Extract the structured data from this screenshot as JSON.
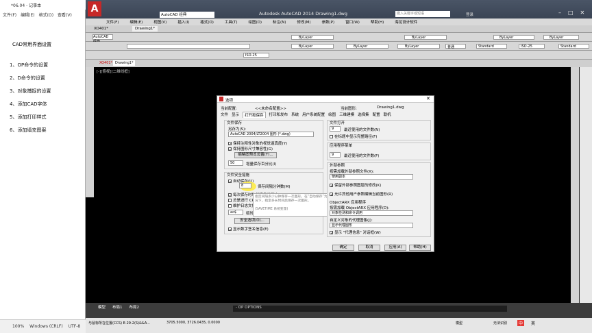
{
  "notepad": {
    "title": "*06.04 - 记事本",
    "menu": [
      "文件(F)",
      "编辑(E)",
      "格式(O)",
      "查看(V)",
      "帮助(H)"
    ],
    "heading": "CAD常用界面设置",
    "items": [
      "1、OP命令的设置",
      "2、D命令的设置",
      "3、对象捕捉的设置",
      "4、添加CAD字体",
      "5、添加打印样式",
      "6、添加填充图案"
    ],
    "status": [
      "100%",
      "Windows (CRLF)",
      "UTF-8"
    ]
  },
  "acad": {
    "workspace": "AutoCAD 经典",
    "title": "Autodesk AutoCAD 2014    Drawing1.dwg",
    "search_placeholder": "键入关键字或短语",
    "login": "登录",
    "menu": [
      "文件(F)",
      "编辑(E)",
      "视图(V)",
      "插入(I)",
      "格式(O)",
      "工具(T)",
      "绘图(D)",
      "标注(N)",
      "修改(M)",
      "参数(P)",
      "窗口(W)",
      "帮助(H)",
      "海龙设计软件"
    ],
    "tabs": [
      "XO401*",
      "Drawing1*"
    ],
    "layer_bylayer": "ByLayer",
    "style_standard": "Standard",
    "dim_style": "ISO-25",
    "plot_style": "普通",
    "view_label": "[-][俯视][二维线框]",
    "model_tabs": [
      "模型",
      "布局1",
      "布局2"
    ],
    "command_line": "- OP OPTIONS",
    "coords": "3705.5000,  3726.0435,  0.0000",
    "status_left": "与鼠标所在位置(CCS)  E-29-2(S)&&A...",
    "status_right": "模型",
    "tray": "无法识别",
    "language": "中",
    "lang_mode": "英"
  },
  "dialog": {
    "title": "选项",
    "current_profile_label": "当前配置:",
    "current_profile": "<<未命名配置>>",
    "current_drawing_label": "当前图形:",
    "current_drawing": "Drawing1.dwg",
    "tabs": [
      "文件",
      "显示",
      "打开和保存",
      "打印和发布",
      "系统",
      "用户系统配置",
      "绘图",
      "三维建模",
      "选择集",
      "配置",
      "联机"
    ],
    "file_save_group": "文件保存",
    "save_as_label": "另存为(S):",
    "save_as_value": "AutoCAD 2004/LT2004 图形 (*.dwg)",
    "cb_keep_annot": "保持注释性对象的视觉逼真度(Y)",
    "cb_keep_size": "保持图形尺寸兼容性(G)",
    "thumbnail_btn": "缩略图预览设置(T)...",
    "incremental_value": "50",
    "incremental_label": "增量保存百分比(I)",
    "safety_group": "文件安全措施",
    "cb_autosave": "自动保存(U)",
    "autosave_minutes": "8",
    "autosave_label": "保存间隔分钟数(M)",
    "cb_backup": "每次保存时均创建备份副本(B)",
    "cb_crc": "总是进行 CRC 校验(V)",
    "cb_log": "维护日志文件(L)",
    "temp_ext": "ac$",
    "temp_label": "临时文件的扩展名(P)",
    "security_btn": "安全选项(O)...",
    "cb_digital": "显示数字签名信息(E)",
    "file_open_group": "文件打开",
    "recent_files_value": "9",
    "recent_files_label": "最近使用的文件数(N)",
    "cb_fullpath": "在标题中显示完整路径(F)",
    "app_menu_group": "应用程序菜单",
    "app_recent_value": "9",
    "app_recent_label": "最近使用的文件数(F)",
    "xref_group": "外部参照",
    "xref_load_label": "按需加载外部参照文件(X):",
    "xref_load_value": "使用副本",
    "cb_keep_layer": "保留外部参照图层的修改(K)",
    "cb_allow_edit": "允许其他用户参照编辑当前图形(R)",
    "objectarx_group": "ObjectARX 应用程序",
    "demand_load_label": "按需加载 ObjectARX 应用程序(D):",
    "demand_load_value": "对象检测和命令调用",
    "proxy_label": "自定义对象的代理图像(J):",
    "proxy_value": "显示代理图形",
    "cb_proxy_dialog": "显示 \"代理信息\" 对话框(W)",
    "tooltip_text": "指定间隔多少分钟保存一次图形。在“自动保存”为开的情况下，指定多长时间后保存一次图形。",
    "tooltip_var": "(SAVETIME 系统变量)",
    "ok": "确定",
    "cancel": "取消",
    "apply": "应用(A)",
    "help": "帮助(H)"
  },
  "colors": {
    "acad_bg": "#000000",
    "dialog_bg": "#f0f0f0",
    "highlight": "#ffeb3b",
    "title_bar": "#3a4454"
  }
}
